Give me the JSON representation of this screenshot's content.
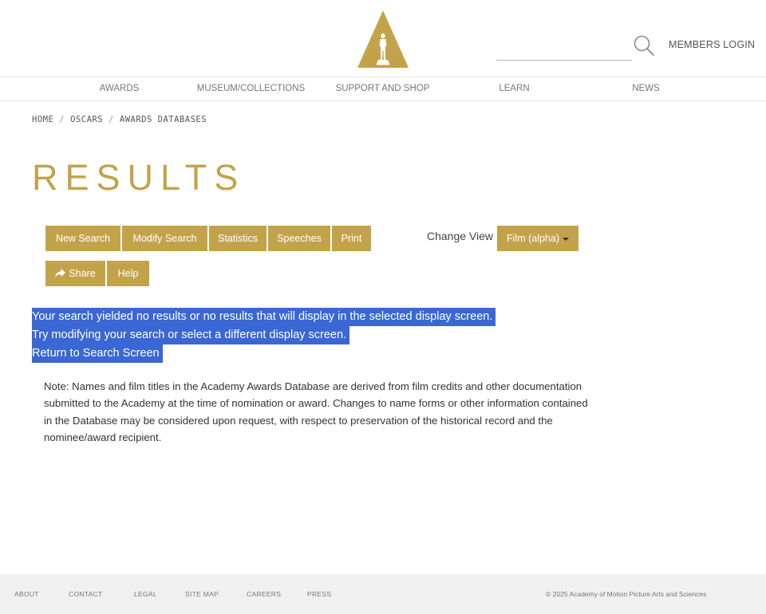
{
  "header": {
    "search_placeholder": "",
    "members_login": "MEMBERS LOGIN"
  },
  "nav": {
    "items": [
      "AWARDS",
      "MUSEUM/COLLECTIONS",
      "SUPPORT AND SHOP",
      "LEARN",
      "NEWS"
    ]
  },
  "breadcrumb": {
    "items": [
      "HOME",
      "OSCARS",
      "AWARDS DATABASES"
    ],
    "separator": "/"
  },
  "page": {
    "title": "RESULTS"
  },
  "toolbar": {
    "new_search": "New Search",
    "modify_search": "Modify Search",
    "statistics": "Statistics",
    "speeches": "Speeches",
    "print": "Print",
    "share": "Share",
    "help": "Help",
    "change_view_label": "Change View",
    "change_view_selected": "Film (alpha)"
  },
  "message": {
    "line1": "Your search yielded no results or no results that will display in the selected display screen.",
    "line2": "Try modifying your search or select a different display screen.",
    "line3": "Return to Search Screen"
  },
  "note": "Note: Names and film titles in the Academy Awards Database are derived from film credits and other documentation submitted to the Academy at the time of nomination or award. Changes to name forms or other information contained in the Database may be considered upon request, with respect to preservation of the historical record and the nominee/award recipient.",
  "footer": {
    "links": [
      "ABOUT",
      "CONTACT",
      "LEGAL",
      "SITE MAP",
      "CAREERS",
      "PRESS"
    ],
    "copyright": "© 2025 Academy of Motion Picture Arts and Sciences"
  },
  "colors": {
    "accent_gold": "#c3a34a",
    "selection_blue": "#3a67d4",
    "footer_bg": "#f0f0f0"
  },
  "icons": {
    "logo": "oscar-statuette-logo",
    "search": "search-icon",
    "share": "share-icon",
    "caret": "caret-down-icon"
  }
}
